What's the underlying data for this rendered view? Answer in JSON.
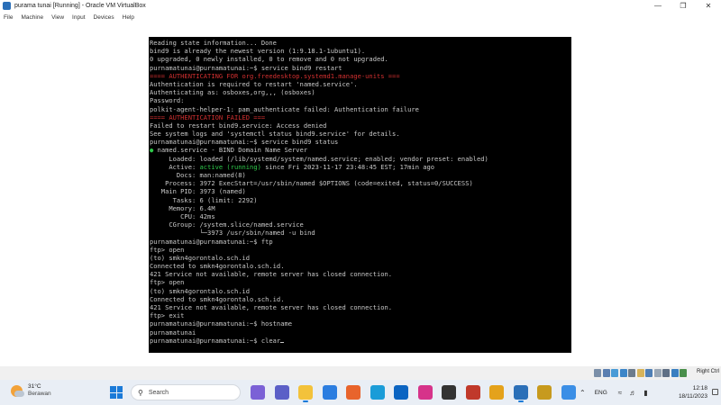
{
  "window": {
    "title": "purama tunai [Running] - Oracle VM VirtualBox",
    "controls": {
      "minimize": "—",
      "maximize": "❐",
      "close": "✕"
    }
  },
  "menu": [
    "File",
    "Machine",
    "View",
    "Input",
    "Devices",
    "Help"
  ],
  "terminal": {
    "lines": [
      {
        "text": "Reading state information... Done",
        "color": "default"
      },
      {
        "text": "bind9 is already the newest version (1:9.18.1-1ubuntu1).",
        "color": "default"
      },
      {
        "text": "0 upgraded, 0 newly installed, 0 to remove and 0 not upgraded.",
        "color": "default"
      },
      {
        "text": "purnamatunai@purnamatunai:~$ service bind9 restart",
        "color": "default"
      },
      {
        "text": "==== AUTHENTICATING FOR org.freedesktop.systemd1.manage-units ===",
        "color": "red"
      },
      {
        "text": "Authentication is required to restart 'named.service'.",
        "color": "default"
      },
      {
        "text": "Authenticating as: osboxes,org,,, (osboxes)",
        "color": "default"
      },
      {
        "text": "Password:",
        "color": "default"
      },
      {
        "text": "polkit-agent-helper-1: pam_authenticate failed: Authentication failure",
        "color": "default"
      },
      {
        "text": "==== AUTHENTICATION FAILED ===",
        "color": "red"
      },
      {
        "text": "Failed to restart bind9.service: Access denied",
        "color": "default"
      },
      {
        "text": "See system logs and 'systemctl status bind9.service' for details.",
        "color": "default"
      },
      {
        "text": "purnamatunai@purnamatunai:~$ service bind9 status",
        "color": "default"
      },
      {
        "text": "● named.service - BIND Domain Name Server",
        "color": "default"
      },
      {
        "text": "     Loaded: loaded (/lib/systemd/system/named.service; enabled; vendor preset: enabled)",
        "color": "default"
      },
      {
        "text": "     Active: active (running) since Fri 2023-11-17 23:48:45 EST; 17min ago",
        "color": "active"
      },
      {
        "text": "       Docs: man:named(8)",
        "color": "default"
      },
      {
        "text": "    Process: 3972 ExecStart=/usr/sbin/named $OPTIONS (code=exited, status=0/SUCCESS)",
        "color": "default"
      },
      {
        "text": "   Main PID: 3973 (named)",
        "color": "default"
      },
      {
        "text": "      Tasks: 6 (limit: 2292)",
        "color": "default"
      },
      {
        "text": "     Memory: 6.4M",
        "color": "default"
      },
      {
        "text": "        CPU: 42ms",
        "color": "default"
      },
      {
        "text": "     CGroup: /system.slice/named.service",
        "color": "default"
      },
      {
        "text": "             └─3973 /usr/sbin/named -u bind",
        "color": "default"
      },
      {
        "text": "purnamatunai@purnamatunai:~$ ftp",
        "color": "default"
      },
      {
        "text": "ftp> open",
        "color": "default"
      },
      {
        "text": "(to) smkn4gorontalo.sch.id",
        "color": "default"
      },
      {
        "text": "Connected to smkn4gorontalo.sch.id.",
        "color": "default"
      },
      {
        "text": "421 Service not available, remote server has closed connection.",
        "color": "default"
      },
      {
        "text": "ftp> open",
        "color": "default"
      },
      {
        "text": "(to) smkn4gorontalo.sch.id",
        "color": "default"
      },
      {
        "text": "Connected to smkn4gorontalo.sch.id.",
        "color": "default"
      },
      {
        "text": "421 Service not available, remote server has closed connection.",
        "color": "default"
      },
      {
        "text": "ftp> exit",
        "color": "default"
      },
      {
        "text": "purnamatunai@purnamatunai:~$ hostname",
        "color": "default"
      },
      {
        "text": "purnamatunai",
        "color": "default"
      },
      {
        "text": "purnamatunai@purnamatunai:~$ clear",
        "color": "default"
      }
    ],
    "colors": {
      "default": "#c8c8c8",
      "red": "#d23030",
      "green": "#2ec84a",
      "background": "#000000"
    }
  },
  "vbox_status": {
    "host_key": "Right Ctrl"
  },
  "taskbar": {
    "weather": {
      "temp": "31°C",
      "condition": "Berawan"
    },
    "search_label": "Search",
    "apps": [
      {
        "name": "copilot-icon",
        "color": "#7b61d6"
      },
      {
        "name": "teams-icon",
        "color": "#5b5fc7"
      },
      {
        "name": "file-explorer-icon",
        "color": "#f3c23b"
      },
      {
        "name": "store-icon",
        "color": "#2b7de0"
      },
      {
        "name": "firefox-icon",
        "color": "#e8642c"
      },
      {
        "name": "edge-icon",
        "color": "#1a9cd8"
      },
      {
        "name": "mail-icon",
        "color": "#0a64c2"
      },
      {
        "name": "app-w-icon",
        "color": "#d6338a"
      },
      {
        "name": "terminal-icon",
        "color": "#333333"
      },
      {
        "name": "app-grid-icon",
        "color": "#c0392b"
      },
      {
        "name": "chrome-icon",
        "color": "#e4a21c"
      },
      {
        "name": "virtualbox-icon",
        "color": "#2a6fb8"
      },
      {
        "name": "app-yellow-icon",
        "color": "#c79a1e"
      },
      {
        "name": "app-blue-icon",
        "color": "#3a8ee6"
      }
    ],
    "language": "ENG",
    "time": "12:18",
    "date": "18/11/2023"
  }
}
